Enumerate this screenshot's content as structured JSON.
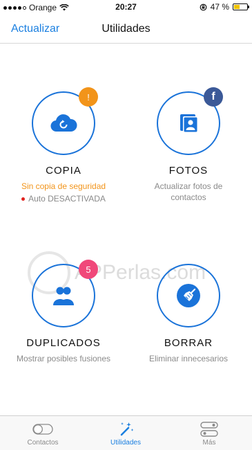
{
  "status_bar": {
    "carrier": "Orange",
    "time": "20:27",
    "battery": "47 %",
    "battery_fill": 0.47
  },
  "nav": {
    "back_label": "Actualizar",
    "title": "Utilidades"
  },
  "watermark": "APPerlas.com",
  "tiles": [
    {
      "label": "COPIA",
      "subtitle": "Sin copia de seguridad",
      "status": "Auto DESACTIVADA",
      "badge": "!"
    },
    {
      "label": "FOTOS",
      "subtitle": "Actualizar fotos de contactos",
      "badge": "f"
    },
    {
      "label": "DUPLICADOS",
      "subtitle": "Mostrar posibles fusiones",
      "badge": "5"
    },
    {
      "label": "BORRAR",
      "subtitle": "Eliminar innecesarios"
    }
  ],
  "tabbar": {
    "items": [
      {
        "label": "Contactos"
      },
      {
        "label": "Utilidades"
      },
      {
        "label": "Más"
      }
    ]
  },
  "colors": {
    "accent": "#1a73d9",
    "warning": "#f2941a",
    "badge_pink": "#f0487a",
    "facebook": "#3b5998",
    "status_red": "#e0231f"
  },
  "icons": {
    "copia": "cloud-restore-icon",
    "fotos": "contact-photos-icon",
    "duplicados": "duplicate-people-icon",
    "borrar": "broom-icon"
  }
}
